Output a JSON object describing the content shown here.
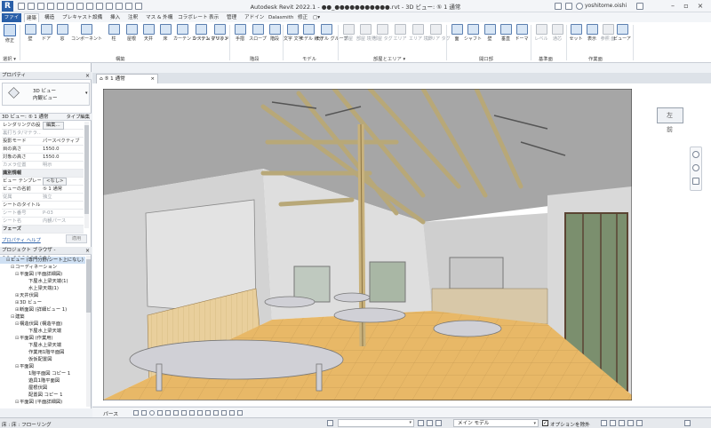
{
  "app": {
    "logo_letter": "R",
    "window_title": "Autodesk Revit 2022.1 - ●●_●●●●●●●●●●●.rvt - 3D ビュー: ⑤ 1 通常",
    "user_name": "yoshitome.oishi"
  },
  "tabs": [
    "ファイル",
    "建築",
    "構造",
    "プレキャスト",
    "設備",
    "挿入",
    "注釈",
    "マス & 外構",
    "コラボレート",
    "表示",
    "管理",
    "アドイン",
    "Dalasmith",
    "修正",
    "▢▾"
  ],
  "ribbon": {
    "buttons": [
      {
        "label": "修正",
        "icon": "modify-arrow-icon",
        "disabled": false
      },
      {
        "label": "壁",
        "icon": "wall-icon",
        "disabled": false
      },
      {
        "label": "ドア",
        "icon": "door-icon",
        "disabled": false
      },
      {
        "label": "窓",
        "icon": "window-icon",
        "disabled": false
      },
      {
        "label": "コンポーネント",
        "icon": "component-icon",
        "disabled": false
      },
      {
        "label": "柱",
        "icon": "column-icon",
        "disabled": false
      },
      {
        "label": "屋根",
        "icon": "roof-icon",
        "disabled": false
      },
      {
        "label": "天井",
        "icon": "ceiling-icon",
        "disabled": false
      },
      {
        "label": "床",
        "icon": "floor-icon",
        "disabled": false
      },
      {
        "label": "カーテン システム",
        "icon": "curtain-system-icon",
        "disabled": false
      },
      {
        "label": "カーテン グリッド",
        "icon": "curtain-grid-icon",
        "disabled": false
      },
      {
        "label": "マリオン",
        "icon": "mullion-icon",
        "disabled": false
      },
      {
        "label": "手摺",
        "icon": "railing-icon",
        "disabled": false
      },
      {
        "label": "スロープ",
        "icon": "ramp-icon",
        "disabled": false
      },
      {
        "label": "階段",
        "icon": "stair-icon",
        "disabled": false
      },
      {
        "label": "文字 文字",
        "icon": "model-text-icon",
        "disabled": false
      },
      {
        "label": "モデル 線分",
        "icon": "model-line-icon",
        "disabled": false
      },
      {
        "label": "モデル グループ",
        "icon": "model-group-icon",
        "disabled": false
      },
      {
        "label": "部屋",
        "icon": "room-icon",
        "disabled": true
      },
      {
        "label": "部屋 境界",
        "icon": "room-separator-icon",
        "disabled": true
      },
      {
        "label": "部屋 タグ",
        "icon": "room-tag-icon",
        "disabled": true
      },
      {
        "label": "エリア",
        "icon": "area-icon",
        "disabled": true
      },
      {
        "label": "エリア 境界",
        "icon": "area-boundary-icon",
        "disabled": true
      },
      {
        "label": "エリア タグ",
        "icon": "area-tag-icon",
        "disabled": true
      },
      {
        "label": "面",
        "icon": "by-face-icon",
        "disabled": false
      },
      {
        "label": "シャフト",
        "icon": "shaft-icon",
        "disabled": false
      },
      {
        "label": "壁",
        "icon": "wall-opening-icon",
        "disabled": false
      },
      {
        "label": "垂直",
        "icon": "vertical-opening-icon",
        "disabled": false
      },
      {
        "label": "ドーマ",
        "icon": "dormer-icon",
        "disabled": false
      },
      {
        "label": "レベル",
        "icon": "level-icon",
        "disabled": true
      },
      {
        "label": "通芯",
        "icon": "grid-icon",
        "disabled": true
      },
      {
        "label": "セット",
        "icon": "set-workplane-icon",
        "disabled": false
      },
      {
        "label": "表示",
        "icon": "show-workplane-icon",
        "disabled": false
      },
      {
        "label": "参照 面",
        "icon": "ref-plane-icon",
        "disabled": true
      },
      {
        "label": "ビューア",
        "icon": "viewer-icon",
        "disabled": false
      }
    ],
    "panels": [
      "選択 ▾",
      "構築",
      "階段",
      "モデル",
      "部屋とエリア ▾",
      "開口部",
      "基準面",
      "作業面"
    ]
  },
  "properties": {
    "header": "プロパティ",
    "type_name_1": "3D ビュー",
    "type_name_2": "内観ビュー",
    "instance_label": "3D ビュー: ⑤ 1 通常",
    "edit_type_label": "タイプ編集",
    "rows": [
      {
        "k": "レンダリングの設...",
        "v": "編集...",
        "btn": true,
        "grey": false,
        "hdr": false
      },
      {
        "k": "裏打ちタ/マテラ...",
        "v": "",
        "btn": false,
        "grey": true,
        "hdr": false
      },
      {
        "k": "投影モード",
        "v": "パースペクティブ",
        "btn": false,
        "grey": false,
        "hdr": false
      },
      {
        "k": "目の高さ",
        "v": "1550.0",
        "btn": false,
        "grey": false,
        "hdr": false
      },
      {
        "k": "対象の高さ",
        "v": "1550.0",
        "btn": false,
        "grey": false,
        "hdr": false
      },
      {
        "k": "カメラ位置",
        "v": "明示",
        "btn": false,
        "grey": true,
        "hdr": false
      },
      {
        "k": "識別情報",
        "v": "",
        "btn": false,
        "grey": false,
        "hdr": true
      },
      {
        "k": "ビュー テンプレート",
        "v": "<なし>",
        "btn": true,
        "grey": false,
        "hdr": false
      },
      {
        "k": "ビューの名前",
        "v": "⑤ 1 通常",
        "btn": false,
        "grey": false,
        "hdr": false
      },
      {
        "k": "従属",
        "v": "独立",
        "btn": false,
        "grey": true,
        "hdr": false
      },
      {
        "k": "シートのタイトル",
        "v": "",
        "btn": false,
        "grey": false,
        "hdr": false
      },
      {
        "k": "シート番号",
        "v": "P-03",
        "btn": false,
        "grey": true,
        "hdr": false
      },
      {
        "k": "シート名",
        "v": "内観パース",
        "btn": false,
        "grey": true,
        "hdr": false
      },
      {
        "k": "フェーズ",
        "v": "",
        "btn": false,
        "grey": false,
        "hdr": true
      }
    ],
    "help_link": "プロパティ ヘルプ",
    "apply_label": "適用"
  },
  "browser": {
    "header": "プロジェクト ブラウザ - ●●_●●●●●●●●●",
    "nodes": [
      {
        "label": "ビュー (専門分野/シート上になし)",
        "indent": 1,
        "toggle": "⊟",
        "sel": true
      },
      {
        "label": "コーディネーション",
        "indent": 2,
        "toggle": "⊟",
        "sel": false
      },
      {
        "label": "平面図 (平面詳細図)",
        "indent": 3,
        "toggle": "⊟",
        "sel": false
      },
      {
        "label": "下屋水上梁天端(1)",
        "indent": 5,
        "toggle": "",
        "sel": false
      },
      {
        "label": "水上梁天端(1)",
        "indent": 5,
        "toggle": "",
        "sel": false
      },
      {
        "label": "天井伏図",
        "indent": 3,
        "toggle": "⊞",
        "sel": false
      },
      {
        "label": "3D ビュー",
        "indent": 3,
        "toggle": "⊞",
        "sel": false
      },
      {
        "label": "断面図 (詳細ビュー 1)",
        "indent": 3,
        "toggle": "⊞",
        "sel": false
      },
      {
        "label": "建築",
        "indent": 2,
        "toggle": "⊟",
        "sel": false
      },
      {
        "label": "構造伏図 (構造平面)",
        "indent": 3,
        "toggle": "⊟",
        "sel": false
      },
      {
        "label": "下屋水上梁天端",
        "indent": 5,
        "toggle": "",
        "sel": false
      },
      {
        "label": "平面図 (作業用)",
        "indent": 3,
        "toggle": "⊟",
        "sel": false
      },
      {
        "label": "下屋水上梁天端",
        "indent": 5,
        "toggle": "",
        "sel": false
      },
      {
        "label": "作業用1階平面図",
        "indent": 5,
        "toggle": "",
        "sel": false
      },
      {
        "label": "仮仮配置図",
        "indent": 5,
        "toggle": "",
        "sel": false
      },
      {
        "label": "平面図",
        "indent": 3,
        "toggle": "⊟",
        "sel": false
      },
      {
        "label": "1階平面図 コピー 1",
        "indent": 5,
        "toggle": "",
        "sel": false
      },
      {
        "label": "遊具1階平面図",
        "indent": 5,
        "toggle": "",
        "sel": false
      },
      {
        "label": "屋根伏図",
        "indent": 5,
        "toggle": "",
        "sel": false
      },
      {
        "label": "配置図 コピー 1",
        "indent": 5,
        "toggle": "",
        "sel": false
      },
      {
        "label": "平面図 (平面詳細図)",
        "indent": 3,
        "toggle": "⊟",
        "sel": false
      }
    ]
  },
  "view": {
    "tab_label": "⑤ 1 通常",
    "viewcube_label": "左前",
    "scale_label": "パース"
  },
  "status": {
    "text": "床 : 床 : フローリング",
    "model_label": "メイン モデル",
    "option_label": "オプションを除外",
    "option_checked": "✓"
  }
}
